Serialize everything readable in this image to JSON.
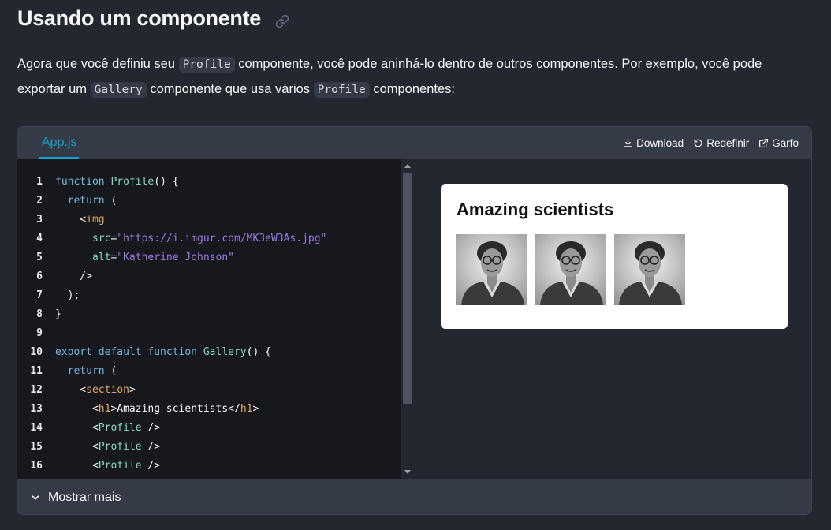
{
  "page": {
    "title": "Usando um componente",
    "intro": {
      "t1": "Agora que você definiu seu ",
      "c1": "Profile",
      "t2": " componente, você pode aninhá-lo dentro de outros componentes. Por exemplo, você pode exportar um ",
      "c2": "Gallery",
      "t3": " componente que usa vários ",
      "c3": "Profile",
      "t4": " componentes:"
    }
  },
  "sandbox": {
    "tab": "App.js",
    "actions": {
      "download": "Download",
      "reset": "Redefinir",
      "fork": "Garfo"
    },
    "code_lines": [
      {
        "n": "1",
        "tokens": [
          [
            "kw",
            "function "
          ],
          [
            "fn",
            "Profile"
          ],
          [
            "plain",
            "() {"
          ]
        ]
      },
      {
        "n": "2",
        "tokens": [
          [
            "kw",
            "  return "
          ],
          [
            "plain",
            "("
          ]
        ]
      },
      {
        "n": "3",
        "tokens": [
          [
            "plain",
            "    <"
          ],
          [
            "tag",
            "img"
          ]
        ]
      },
      {
        "n": "4",
        "tokens": [
          [
            "attr",
            "      src"
          ],
          [
            "plain",
            "="
          ],
          [
            "str",
            "\"https://i.imgur.com/MK3eW3As.jpg\""
          ]
        ]
      },
      {
        "n": "5",
        "tokens": [
          [
            "attr",
            "      alt"
          ],
          [
            "plain",
            "="
          ],
          [
            "str",
            "\"Katherine Johnson\""
          ]
        ]
      },
      {
        "n": "6",
        "tokens": [
          [
            "plain",
            "    />"
          ]
        ]
      },
      {
        "n": "7",
        "tokens": [
          [
            "plain",
            "  );"
          ]
        ]
      },
      {
        "n": "8",
        "tokens": [
          [
            "plain",
            "}"
          ]
        ]
      },
      {
        "n": "9",
        "tokens": []
      },
      {
        "n": "10",
        "tokens": [
          [
            "kw",
            "export default function "
          ],
          [
            "fn",
            "Gallery"
          ],
          [
            "plain",
            "() {"
          ]
        ]
      },
      {
        "n": "11",
        "tokens": [
          [
            "kw",
            "  return "
          ],
          [
            "plain",
            "("
          ]
        ]
      },
      {
        "n": "12",
        "tokens": [
          [
            "plain",
            "    <"
          ],
          [
            "tag",
            "section"
          ],
          [
            "plain",
            ">"
          ]
        ]
      },
      {
        "n": "13",
        "tokens": [
          [
            "plain",
            "      <"
          ],
          [
            "tag",
            "h1"
          ],
          [
            "plain",
            ">Amazing scientists</"
          ],
          [
            "tag",
            "h1"
          ],
          [
            "plain",
            ">"
          ]
        ]
      },
      {
        "n": "14",
        "tokens": [
          [
            "plain",
            "      <"
          ],
          [
            "comp",
            "Profile"
          ],
          [
            "plain",
            " />"
          ]
        ]
      },
      {
        "n": "15",
        "tokens": [
          [
            "plain",
            "      <"
          ],
          [
            "comp",
            "Profile"
          ],
          [
            "plain",
            " />"
          ]
        ]
      },
      {
        "n": "16",
        "tokens": [
          [
            "plain",
            "      <"
          ],
          [
            "comp",
            "Profile"
          ],
          [
            "plain",
            " />"
          ]
        ]
      }
    ],
    "preview": {
      "heading": "Amazing scientists",
      "photo_count": 3
    },
    "footer": "Mostrar mais"
  }
}
